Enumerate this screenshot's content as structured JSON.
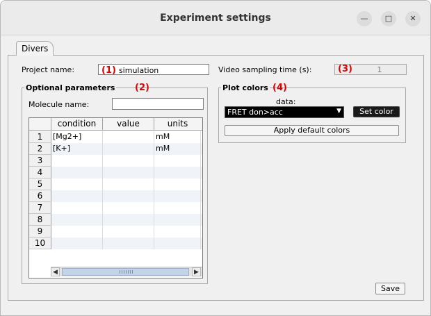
{
  "window": {
    "title": "Experiment settings"
  },
  "tabs": [
    {
      "label": "Divers"
    }
  ],
  "project": {
    "label": "Project name:",
    "marker": "(1)",
    "value": "simulation"
  },
  "video": {
    "label": "Video sampling time (s):",
    "marker": "(3)",
    "value": "1"
  },
  "optional_parameters": {
    "title": "Optional parameters",
    "marker": "(2)",
    "molecule_label": "Molecule name:",
    "molecule_value": "",
    "table": {
      "columns": [
        "condition",
        "value",
        "units"
      ],
      "rows": [
        {
          "index": "1",
          "condition": "[Mg2+]",
          "value": "",
          "units": "mM"
        },
        {
          "index": "2",
          "condition": "[K+]",
          "value": "",
          "units": "mM"
        },
        {
          "index": "3",
          "condition": "",
          "value": "",
          "units": ""
        },
        {
          "index": "4",
          "condition": "",
          "value": "",
          "units": ""
        },
        {
          "index": "5",
          "condition": "",
          "value": "",
          "units": ""
        },
        {
          "index": "6",
          "condition": "",
          "value": "",
          "units": ""
        },
        {
          "index": "7",
          "condition": "",
          "value": "",
          "units": ""
        },
        {
          "index": "8",
          "condition": "",
          "value": "",
          "units": ""
        },
        {
          "index": "9",
          "condition": "",
          "value": "",
          "units": ""
        },
        {
          "index": "10",
          "condition": "",
          "value": "",
          "units": ""
        }
      ]
    }
  },
  "plot_colors": {
    "title": "Plot colors",
    "marker": "(4)",
    "data_label": "data:",
    "selected": "FRET don>acc",
    "set_color_label": "Set color",
    "apply_default_label": "Apply default colors"
  },
  "save_label": "Save",
  "colors": {
    "marker": "#e00000",
    "selection_bg": "#000000"
  },
  "icons": {
    "minimize": "minimize-icon",
    "maximize": "maximize-icon",
    "close": "close-icon",
    "dropdown": "chevron-down-icon",
    "scroll_left": "arrow-left-icon",
    "scroll_right": "arrow-right-icon"
  }
}
